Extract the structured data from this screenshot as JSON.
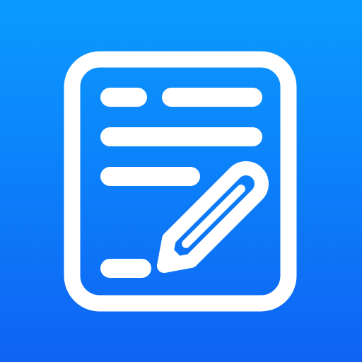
{
  "icon": {
    "name": "notes-editor-app-icon",
    "glyph": "document-with-pencil",
    "colors": {
      "gradient_top": "#0a9bff",
      "gradient_bottom": "#0f63f4",
      "foreground": "#ffffff"
    }
  }
}
